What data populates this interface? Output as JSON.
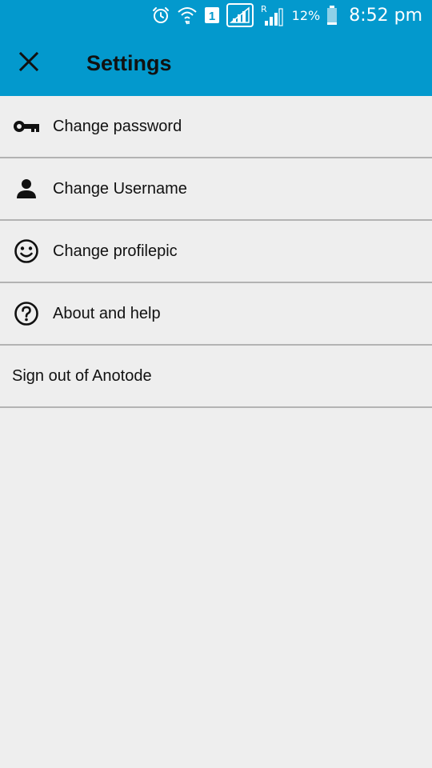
{
  "status_bar": {
    "sim_slot": "1",
    "roaming": "R",
    "battery_percent": "12%",
    "time": "8:52 pm",
    "icons": [
      "alarm-icon",
      "wifi-icon",
      "sim-icon",
      "signal-icon",
      "roaming-signal-icon",
      "battery-icon"
    ]
  },
  "app_bar": {
    "title": "Settings",
    "close_icon": "close-icon",
    "background": "#0399cd"
  },
  "menu": {
    "items": [
      {
        "label": "Change password",
        "icon": "key-icon"
      },
      {
        "label": "Change Username",
        "icon": "person-icon"
      },
      {
        "label": "Change profilepic",
        "icon": "smiley-icon"
      },
      {
        "label": "About and help",
        "icon": "help-circle-icon"
      },
      {
        "label": "Sign out of Anotode",
        "icon": ""
      }
    ]
  }
}
